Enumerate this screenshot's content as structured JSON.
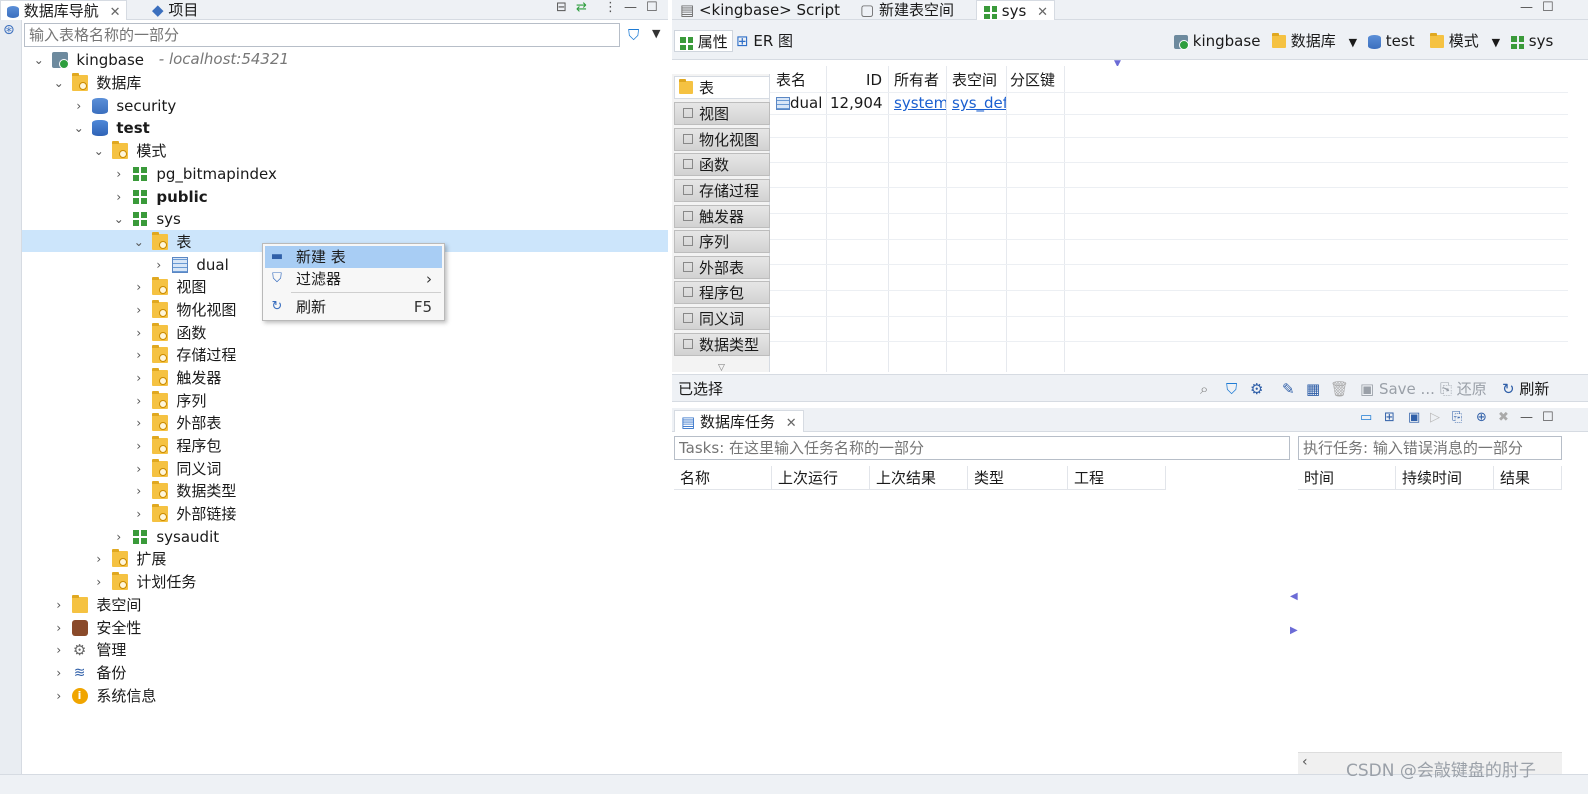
{
  "left_panel": {
    "tabs": [
      {
        "label": "数据库导航",
        "active": true
      },
      {
        "label": "项目",
        "active": false
      }
    ],
    "filter_placeholder": "输入表格名称的一部分",
    "tree": [
      {
        "label": "kingbase",
        "sub": "- localhost:54321"
      },
      {
        "label": "数据库"
      },
      {
        "label": "security"
      },
      {
        "label": "test"
      },
      {
        "label": "模式"
      },
      {
        "label": "pg_bitmapindex"
      },
      {
        "label": "public"
      },
      {
        "label": "sys"
      },
      {
        "label": "表"
      },
      {
        "label": "dual"
      },
      {
        "label": "视图"
      },
      {
        "label": "物化视图"
      },
      {
        "label": "函数"
      },
      {
        "label": "存储过程"
      },
      {
        "label": "触发器"
      },
      {
        "label": "序列"
      },
      {
        "label": "外部表"
      },
      {
        "label": "程序包"
      },
      {
        "label": "同义词"
      },
      {
        "label": "数据类型"
      },
      {
        "label": "外部链接"
      },
      {
        "label": "sysaudit"
      },
      {
        "label": "扩展"
      },
      {
        "label": "计划任务"
      },
      {
        "label": "表空间"
      },
      {
        "label": "安全性"
      },
      {
        "label": "管理"
      },
      {
        "label": "备份"
      },
      {
        "label": "系统信息"
      }
    ]
  },
  "context_menu": {
    "items": [
      {
        "label": "新建 表",
        "shortcut": ""
      },
      {
        "label": "过滤器",
        "shortcut": "›"
      },
      {
        "label": "刷新",
        "shortcut": "F5"
      }
    ]
  },
  "editor": {
    "tabs": [
      {
        "label": "<kingbase> Script"
      },
      {
        "label": "新建表空间"
      },
      {
        "label": "sys"
      }
    ],
    "subtabs": [
      "属性",
      "ER 图"
    ],
    "breadcrumb": [
      "kingbase",
      "数据库",
      "test",
      "模式",
      "sys"
    ],
    "categories": [
      "表",
      "视图",
      "物化视图",
      "函数",
      "存储过程",
      "触发器",
      "序列",
      "外部表",
      "程序包",
      "同义词",
      "数据类型"
    ],
    "columns": [
      "表名",
      "ID",
      "所有者",
      "表空间",
      "分区键"
    ],
    "rows": [
      {
        "name": "dual",
        "id": "12,904",
        "owner": "system",
        "tablespace": "sys_def",
        "partition": ""
      }
    ],
    "status_left": "已选择",
    "save_label": "Save ...",
    "revert_label": "还原",
    "refresh_label": "刷新"
  },
  "tasks": {
    "tab_label": "数据库任务",
    "filter_placeholder": "Tasks: 在这里输入任务名称的一部分",
    "exec_placeholder": "执行任务: 输入错误消息的一部分",
    "columns": [
      "名称",
      "上次运行",
      "上次结果",
      "类型",
      "工程"
    ],
    "exec_columns": [
      "时间",
      "持续时间",
      "结果"
    ]
  },
  "watermark": "CSDN @会敲键盘的肘子",
  "colors": {
    "accent": "#1e7bd4",
    "selection": "#cce5fb",
    "menu_highlight": "#a8cdf4",
    "link": "#1a5fd0",
    "folder": "#f5c242",
    "schema": "#3a9a3a"
  }
}
